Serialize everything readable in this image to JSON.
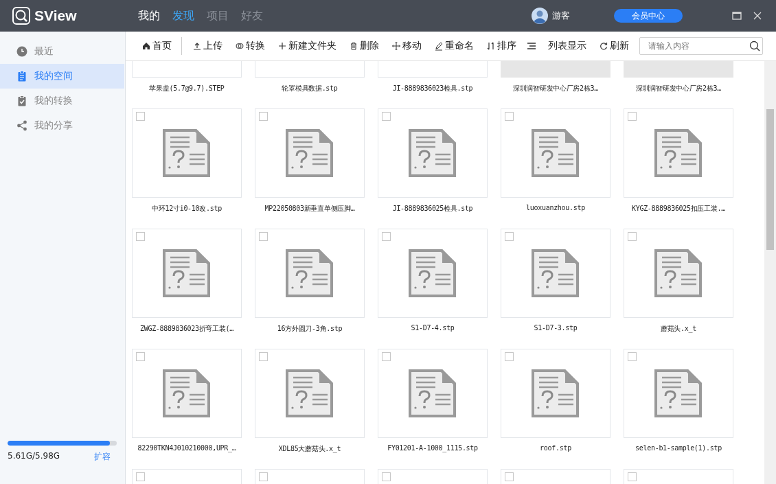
{
  "app": {
    "logo_text": "SView"
  },
  "nav_tabs": [
    {
      "label": "我的",
      "selected": false,
      "disabled": false
    },
    {
      "label": "发现",
      "selected": true,
      "disabled": false
    },
    {
      "label": "项目",
      "selected": false,
      "disabled": true
    },
    {
      "label": "好友",
      "selected": false,
      "disabled": true
    }
  ],
  "user": {
    "name": "游客"
  },
  "member_button": "会员中心",
  "sidebar": {
    "items": [
      {
        "label": "最近",
        "kind": "clock",
        "selected": false
      },
      {
        "label": "我的空间",
        "kind": "clipboard",
        "selected": true
      },
      {
        "label": "我的转换",
        "kind": "check",
        "selected": false
      },
      {
        "label": "我的分享",
        "kind": "share",
        "selected": false
      }
    ],
    "storage": {
      "level": 0.94,
      "text": "5.61G/5.98G",
      "action": "扩容"
    }
  },
  "toolbar": {
    "items": [
      {
        "label": "首页",
        "kind": "home"
      },
      {
        "label": "上传",
        "kind": "upload"
      },
      {
        "label": "转换",
        "kind": "convert"
      },
      {
        "label": "新建文件夹",
        "kind": "plus"
      },
      {
        "label": "删除",
        "kind": "trash"
      },
      {
        "label": "移动",
        "kind": "move"
      },
      {
        "label": "重命名",
        "kind": "pen"
      },
      {
        "label": "排序",
        "kind": "sort"
      },
      {
        "label": "列表显示",
        "kind": "list"
      },
      {
        "label": "刷新",
        "kind": "refresh"
      }
    ],
    "search": {
      "placeholder": "请输入内容"
    }
  },
  "files": [
    {
      "name": "苹果盖(5.7@9.7).STEP",
      "kind": "blank"
    },
    {
      "name": "轮罩模具数据.stp",
      "kind": "blank"
    },
    {
      "name": "JI-8889836023检具.stp",
      "kind": "blank"
    },
    {
      "name": "深圳润智研发中心厂房2栋3…",
      "kind": "gray"
    },
    {
      "name": "深圳润智研发中心厂房2栋3…",
      "kind": "gray"
    },
    {
      "name": "中环12寸i0-10改.stp",
      "kind": "doc",
      "checked": false
    },
    {
      "name": "MP22050803新垂直单侧压脚…",
      "kind": "doc",
      "checked": false
    },
    {
      "name": "JI-8889836025检具.stp",
      "kind": "doc",
      "checked": false
    },
    {
      "name": "luoxuanzhou.stp",
      "kind": "doc",
      "checked": false
    },
    {
      "name": "KYGZ-8889836025扣压工装.…",
      "kind": "doc",
      "checked": false
    },
    {
      "name": "ZWGZ-8889836023折弯工装(…",
      "kind": "doc",
      "checked": false
    },
    {
      "name": "16方外圆刀-3角.stp",
      "kind": "doc",
      "checked": false
    },
    {
      "name": "S1-D7-4.stp",
      "kind": "doc",
      "checked": false
    },
    {
      "name": "S1-D7-3.stp",
      "kind": "doc",
      "checked": false
    },
    {
      "name": "蘑菇头.x_t",
      "kind": "doc",
      "checked": false
    },
    {
      "name": "82290TKN4J010210000,UPR_…",
      "kind": "doc",
      "checked": false
    },
    {
      "name": "XDL85大蘑菇头.x_t",
      "kind": "doc",
      "checked": false
    },
    {
      "name": "FY01201-A-1000_1115.stp",
      "kind": "doc",
      "checked": false
    },
    {
      "name": "roof.stp",
      "kind": "doc",
      "checked": false
    },
    {
      "name": "selen-b1-sample(1).stp",
      "kind": "doc",
      "checked": false
    },
    {
      "kind": "cut",
      "checked": false
    },
    {
      "kind": "cut",
      "checked": false
    },
    {
      "kind": "cut",
      "checked": false
    },
    {
      "kind": "cut",
      "checked": false
    },
    {
      "kind": "cut",
      "checked": false
    }
  ]
}
